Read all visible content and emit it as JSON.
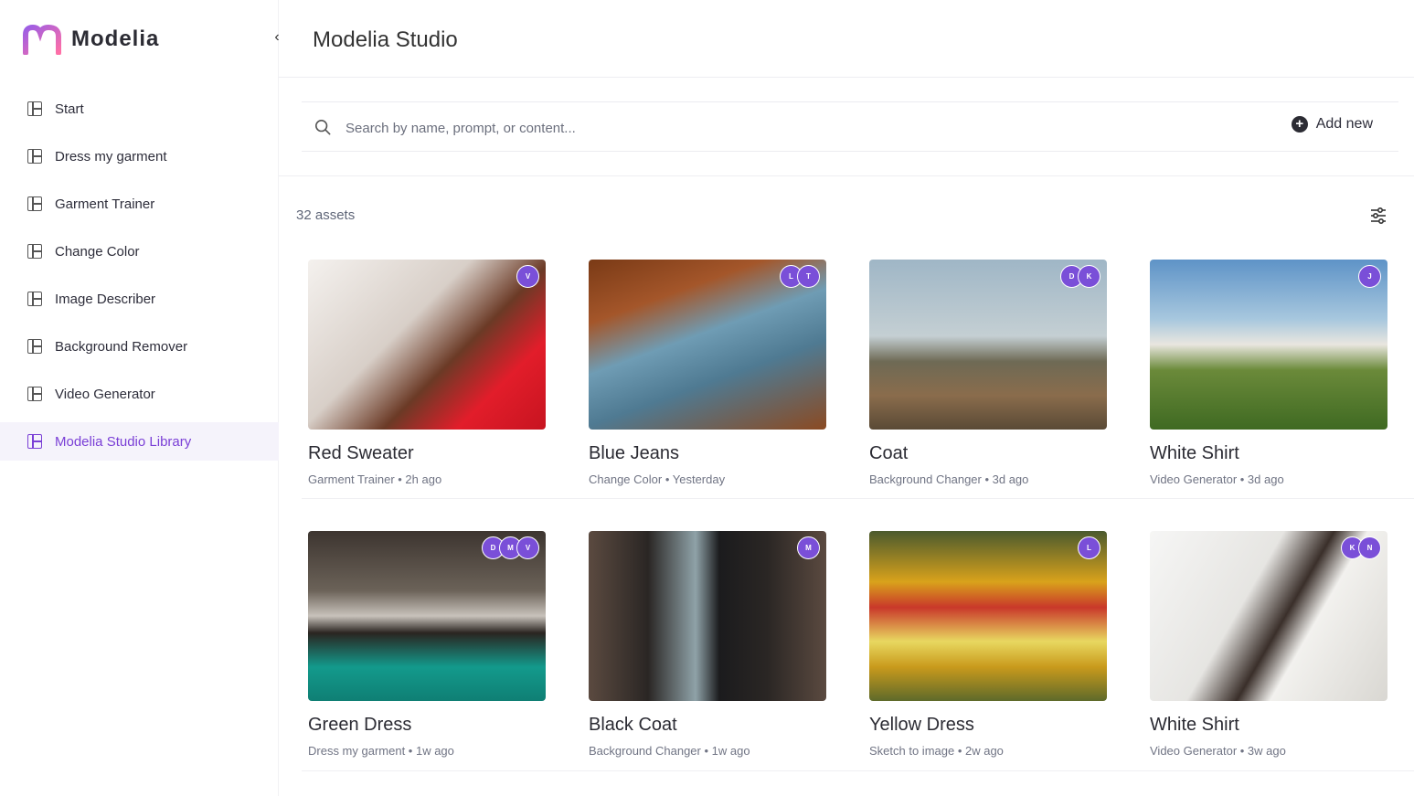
{
  "brand": {
    "name": "Modelia",
    "logo_gradient": [
      "#9b5de5",
      "#ff6fa6"
    ]
  },
  "header": {
    "title": "Modelia Studio",
    "collapse_icon": "chevron-left-icon"
  },
  "sidebar": {
    "items": [
      {
        "label": "Start",
        "active": false
      },
      {
        "label": "Dress my garment",
        "active": false
      },
      {
        "label": "Garment Trainer",
        "active": false
      },
      {
        "label": "Change Color",
        "active": false
      },
      {
        "label": "Image Describer",
        "active": false
      },
      {
        "label": "Background Remover",
        "active": false
      },
      {
        "label": "Video Generator",
        "active": false
      },
      {
        "label": "Modelia Studio Library",
        "active": true
      }
    ]
  },
  "search": {
    "placeholder": "Search by name, prompt, or content...",
    "value": ""
  },
  "toolbar": {
    "add_new_label": "Add new"
  },
  "library": {
    "count_label": "32 assets"
  },
  "colors": {
    "accent": "#7a3fd6",
    "avatar": "#7a4fd8"
  },
  "assets": [
    {
      "title": "Red Sweater",
      "meta": "Garment Trainer • 2h ago",
      "avatars": [
        "V"
      ]
    },
    {
      "title": "Blue Jeans",
      "meta": "Change Color • Yesterday",
      "avatars": [
        "L",
        "T"
      ]
    },
    {
      "title": "Coat",
      "meta": "Background Changer • 3d ago",
      "avatars": [
        "D",
        "K"
      ]
    },
    {
      "title": "White Shirt",
      "meta": "Video Generator • 3d ago",
      "avatars": [
        "J"
      ]
    },
    {
      "title": "Green Dress",
      "meta": "Dress my garment • 1w ago",
      "avatars": [
        "D",
        "M",
        "V"
      ]
    },
    {
      "title": "Black Coat",
      "meta": "Background Changer • 1w ago",
      "avatars": [
        "M"
      ]
    },
    {
      "title": "Yellow Dress",
      "meta": "Sketch to image • 2w ago",
      "avatars": [
        "L"
      ]
    },
    {
      "title": "White Shirt",
      "meta": "Video Generator • 3w ago",
      "avatars": [
        "K",
        "N"
      ]
    }
  ]
}
